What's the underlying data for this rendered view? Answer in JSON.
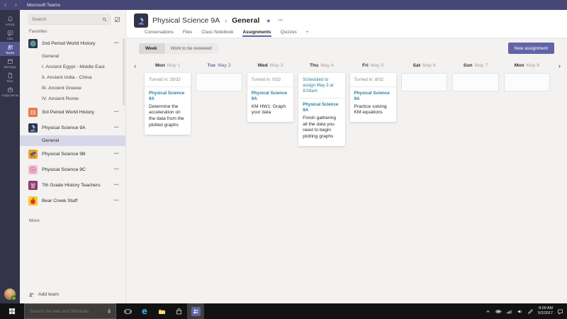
{
  "app": {
    "title": "Microsoft Teams"
  },
  "icons": {
    "back": "‹",
    "forward": "›",
    "more": "•••",
    "breadcrumb_separator": "›",
    "favorite_star": "★",
    "chevron_left": "‹",
    "chevron_right": "›"
  },
  "colors": {
    "accent": "#6264a7",
    "titlebar": "#464775",
    "rail": "#33344a",
    "class_link_teal": "#2c7d9c",
    "presence_green": "#6bb700"
  },
  "rail": {
    "items": [
      {
        "label": "Activity"
      },
      {
        "label": "Chat"
      },
      {
        "label": "Teams"
      },
      {
        "label": "Meetings"
      },
      {
        "label": "Files"
      },
      {
        "label": "Assignments"
      }
    ],
    "selected": "Teams"
  },
  "sidebar": {
    "search_placeholder": "Search",
    "favorites_label": "Favorites",
    "world_history_2nd": {
      "name": "2nd Period World History",
      "channels": [
        "General",
        "I. Ancient Egypt - Middle East",
        "II. Ancient India - China",
        "III. Ancient Greece",
        "IV. Ancient Rome"
      ]
    },
    "world_history_3rd": {
      "name": "3rd Period World History"
    },
    "physical_science_9a": {
      "name": "Physical Science 9A",
      "channel": "General"
    },
    "physical_science_9b": {
      "name": "Physical Science 9B"
    },
    "physical_science_9c": {
      "name": "Physical Science 9C"
    },
    "history_teachers": {
      "name": "7th Grade History Teachers"
    },
    "bear_creek": {
      "name": "Bear Creek Staff"
    },
    "more_label": "More",
    "add_team_label": "Add team"
  },
  "header": {
    "team": "Physical Science 9A",
    "channel": "General",
    "tabs": [
      {
        "label": "Conversations"
      },
      {
        "label": "Files"
      },
      {
        "label": "Class Notebook"
      },
      {
        "label": "Assignments"
      },
      {
        "label": "Quizzes"
      },
      {
        "label": "+"
      }
    ],
    "active_tab": "Assignments"
  },
  "toolbar": {
    "week": "Week",
    "review": "Work to be reviewed",
    "new_assignment": "New assignment"
  },
  "calendar": {
    "days": [
      {
        "day": "Mon",
        "date": "May 1",
        "card": {
          "status": "Turned in: 29/32",
          "class": "Physical Science 9A",
          "title": "Determine the acceleration on the data from the plotted graphs"
        }
      },
      {
        "day": "Tue",
        "date": "May 2",
        "today": true
      },
      {
        "day": "Wed",
        "date": "May 3",
        "card": {
          "status": "Turned in: 0/32",
          "class": "Physical Science 9A",
          "title": "KM HW1: Graph your data"
        }
      },
      {
        "day": "Thu",
        "date": "May 4",
        "card": {
          "status": "Scheduled to assign May 3 at 9:00am",
          "class": "Physical Science 9A",
          "title": "Finish gathering all the data you need to begin plotting graphs"
        }
      },
      {
        "day": "Fri",
        "date": "May 5",
        "card": {
          "status": "Turned in: 8/32",
          "class": "Physical Science 9A",
          "title": "Practice solving KM equations"
        }
      },
      {
        "day": "Sat",
        "date": "May 6"
      },
      {
        "day": "Sun",
        "date": "May 7"
      },
      {
        "day": "Mon",
        "date": "May 8"
      }
    ]
  },
  "taskbar": {
    "search_placeholder": "Search the web and Windows",
    "time": "8:00 AM",
    "date": "5/2/2017"
  }
}
